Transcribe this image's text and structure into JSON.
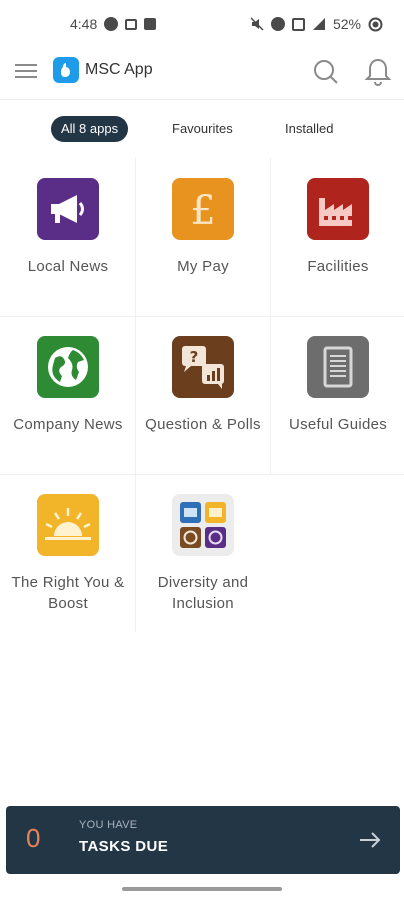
{
  "status_bar": {
    "time": "4:48",
    "battery": "52%"
  },
  "app_bar": {
    "title": "MSC App"
  },
  "tabs": [
    {
      "label": "All 8 apps",
      "active": true
    },
    {
      "label": "Favourites",
      "active": false
    },
    {
      "label": "Installed",
      "active": false
    }
  ],
  "apps": [
    {
      "label": "Local News",
      "icon": "megaphone-icon",
      "color": "#5a2d86"
    },
    {
      "label": "My Pay",
      "icon": "pound-icon",
      "color": "#e8931f"
    },
    {
      "label": "Facilities",
      "icon": "factory-icon",
      "color": "#b0241e"
    },
    {
      "label": "Company News",
      "icon": "globe-icon",
      "color": "#2e8b34"
    },
    {
      "label": "Question & Polls",
      "icon": "poll-icon",
      "color": "#6b3f1e"
    },
    {
      "label": "Useful Guides",
      "icon": "document-icon",
      "color": "#6d6d6d"
    },
    {
      "label": "The Right You & Boost",
      "icon": "sunrise-icon",
      "color": "#f2b52a"
    },
    {
      "label": "Diversity and Inclusion",
      "icon": "diversity-icon",
      "color": "#ececec"
    }
  ],
  "tasks": {
    "count": "0",
    "subtitle": "YOU HAVE",
    "title": "TASKS DUE"
  }
}
